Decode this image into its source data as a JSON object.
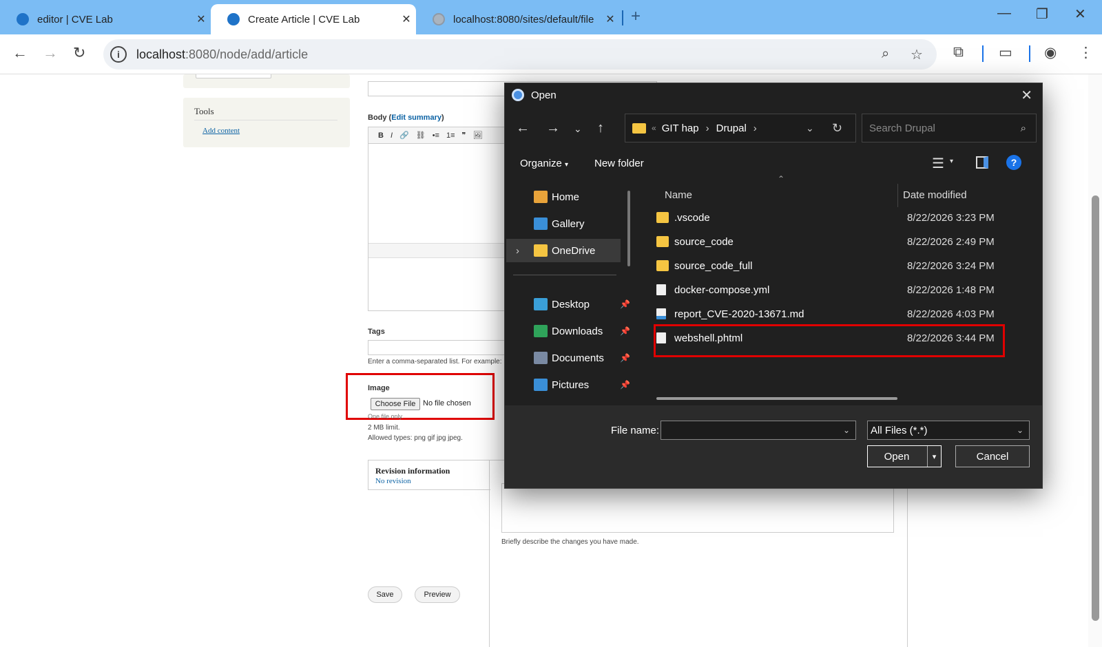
{
  "browser": {
    "tabs": [
      {
        "title": "editor | CVE Lab",
        "icon": "drupal-icon"
      },
      {
        "title": "Create Article | CVE Lab",
        "icon": "drupal-icon"
      },
      {
        "title": "localhost:8080/sites/default/file",
        "icon": "globe-icon"
      }
    ],
    "new_tab": "+",
    "url_host": "localhost",
    "url_rest": ":8080/node/add/article",
    "close_glyph": "✕"
  },
  "page": {
    "tools_title": "Tools",
    "add_content": "Add content",
    "body_label": "Body",
    "edit_summary": "Edit summary",
    "tags_label": "Tags",
    "tags_help": "Enter a comma-separated list. For example: ",
    "image_label": "Image",
    "choose_file": "Choose File",
    "no_file": "No file chosen",
    "one_file": "One file only.",
    "size_limit": "2 MB limit.",
    "allowed": "Allowed types: png gif jpg jpeg.",
    "revision_title": "Revision information",
    "revision_value": "No revision",
    "revision_help": "Briefly describe the changes you have made.",
    "save": "Save",
    "preview": "Preview",
    "toolbar_glyphs": [
      "B",
      "I",
      "🔗",
      "⛓",
      "•≡",
      "1≡",
      "❞",
      "🖼"
    ]
  },
  "dialog": {
    "title": "Open",
    "path": [
      "GIT hap",
      "Drupal"
    ],
    "search_placeholder": "Search Drupal",
    "organize": "Organize",
    "new_folder": "New folder",
    "help": "?",
    "nav": [
      {
        "label": "Home",
        "icon": "home-icon",
        "color": "#e8a33a"
      },
      {
        "label": "Gallery",
        "icon": "gallery-icon",
        "color": "#3a8fd8"
      },
      {
        "label": "OneDrive",
        "icon": "folder-icon",
        "color": "#f5c542"
      },
      {
        "label": "Desktop",
        "icon": "desktop-icon",
        "color": "#3a9fd8"
      },
      {
        "label": "Downloads",
        "icon": "download-icon",
        "color": "#2fa35a"
      },
      {
        "label": "Documents",
        "icon": "documents-icon",
        "color": "#7a8aa3"
      },
      {
        "label": "Pictures",
        "icon": "pictures-icon",
        "color": "#3a8fd8"
      }
    ],
    "col_name": "Name",
    "col_date": "Date modified",
    "files": [
      {
        "name": ".vscode",
        "date": "8/22/2026 3:23 PM",
        "type": "folder"
      },
      {
        "name": "source_code",
        "date": "8/22/2026 2:49 PM",
        "type": "folder"
      },
      {
        "name": "source_code_full",
        "date": "8/22/2026 3:24 PM",
        "type": "folder"
      },
      {
        "name": "docker-compose.yml",
        "date": "8/22/2026 1:48 PM",
        "type": "file"
      },
      {
        "name": "report_CVE-2020-13671.md",
        "date": "8/22/2026 4:03 PM",
        "type": "file"
      },
      {
        "name": "webshell.phtml",
        "date": "8/22/2026 3:44 PM",
        "type": "file"
      }
    ],
    "file_name_label": "File name:",
    "file_name_value": "",
    "filter": "All Files (*.*)",
    "open": "Open",
    "cancel": "Cancel"
  }
}
